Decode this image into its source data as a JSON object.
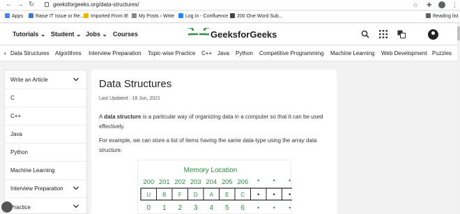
{
  "browser": {
    "url": "geeksforgeeks.org/data-structures/",
    "bookmarks": [
      {
        "label": "Apps",
        "color": "#4285f4"
      },
      {
        "label": "Raise IT Issue or Re...",
        "color": "#3c78d8"
      },
      {
        "label": "Imported From IE",
        "color": "#f4b400"
      },
      {
        "label": "My Posts ‹ Write",
        "color": "#888888"
      },
      {
        "label": "Log In - Confluence",
        "color": "#2684ff"
      },
      {
        "label": "200 One Word Sub...",
        "color": "#444444"
      }
    ],
    "reading_list": "Reading list"
  },
  "header": {
    "menus": [
      "Tutorials",
      "Student",
      "Jobs",
      "Courses"
    ],
    "logo_text": "GeeksforGeeks",
    "brand_color": "#2f8d46"
  },
  "topics": [
    "Data Structures",
    "Algorithms",
    "Interview Preparation",
    "Topic-wise Practice",
    "C++",
    "Java",
    "Python",
    "Competitive Programming",
    "Machine Learning",
    "Web Development",
    "Puzzles"
  ],
  "sidebar": {
    "items": [
      {
        "label": "Write an Article",
        "chevron": true
      },
      {
        "label": "C",
        "chevron": false
      },
      {
        "label": "C++",
        "chevron": false
      },
      {
        "label": "Java",
        "chevron": false
      },
      {
        "label": "Python",
        "chevron": false
      },
      {
        "label": "Machine Learning",
        "chevron": false
      },
      {
        "label": "Interview Preparation",
        "chevron": true
      },
      {
        "label": "Practice",
        "chevron": true
      }
    ]
  },
  "article": {
    "title": "Data Structures",
    "date": "Last Updated : 18 Jun, 2021",
    "p1_pre": "A ",
    "p1_bold": "data structure",
    "p1_post": " is a particular way of organizing data in a computer so that it can be used effectively.",
    "p2_pre": "For example, we can store a list of items having the same data-type using the ",
    "p2_em": "array",
    "p2_post": " data structure."
  },
  "diagram": {
    "title": "Memory Location",
    "addresses": [
      "200",
      "201",
      "202",
      "203",
      "204",
      "205",
      "206"
    ],
    "cells": [
      "U",
      "B",
      "F",
      "D",
      "A",
      "E",
      "C"
    ],
    "indices": [
      "0",
      "1",
      "2",
      "3",
      "4",
      "5",
      "6"
    ],
    "dot": "•",
    "color": "#2f8d46"
  }
}
